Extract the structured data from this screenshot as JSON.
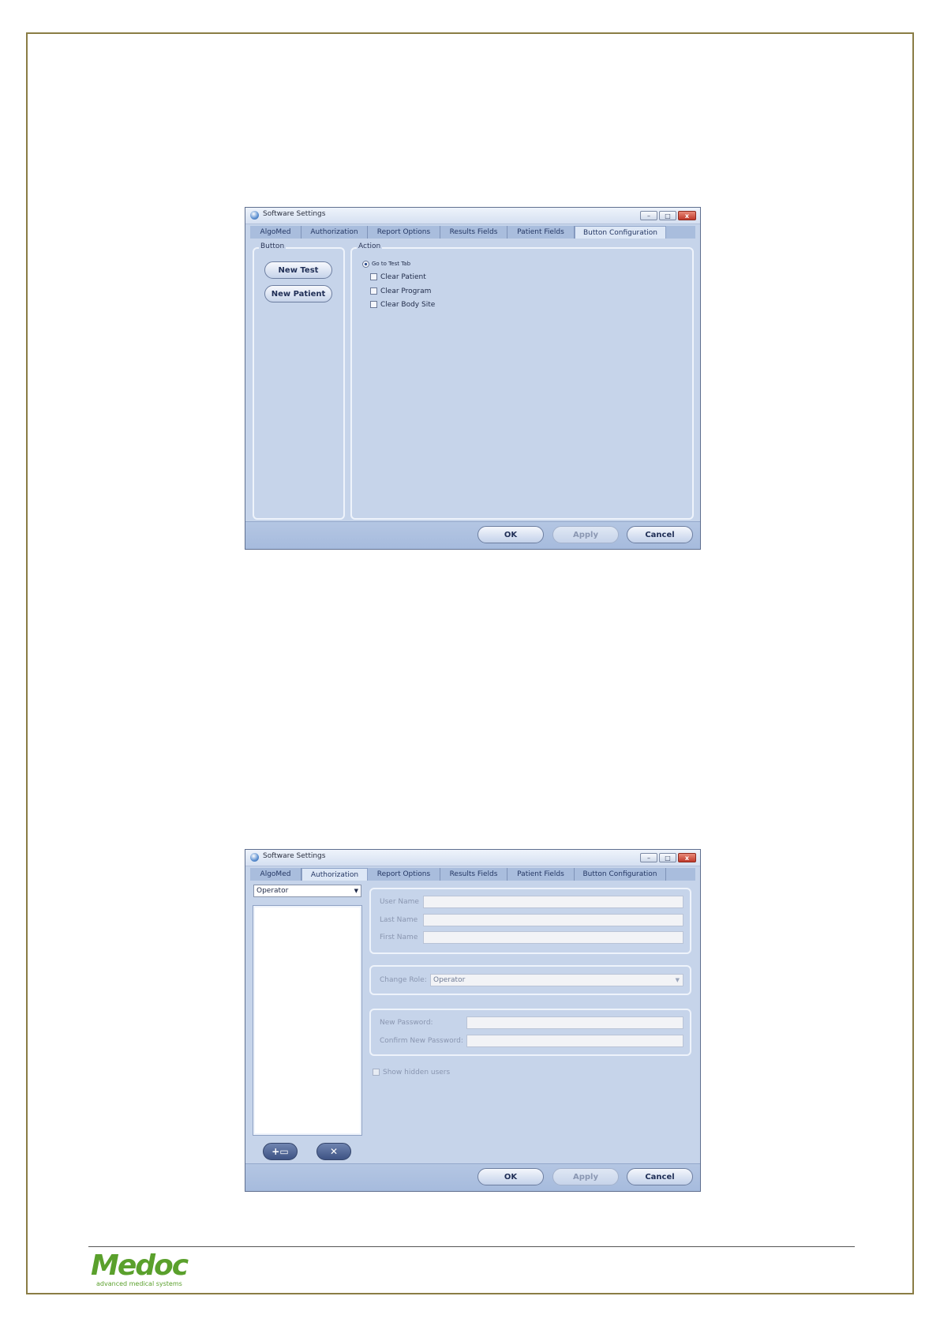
{
  "window_title": "Software Settings",
  "window_buttons": {
    "minimize": "–",
    "maximize": "□",
    "close": "x"
  },
  "tabs": [
    "AlgoMed",
    "Authorization",
    "Report Options",
    "Results Fields",
    "Patient Fields",
    "Button Configuration"
  ],
  "footer_buttons": {
    "ok": "OK",
    "apply": "Apply",
    "cancel": "Cancel"
  },
  "screen1": {
    "active_tab": "Button Configuration",
    "button_group_label": "Button",
    "buttons": [
      "New Test",
      "New Patient"
    ],
    "action_group_label": "Action",
    "radio_option": "Go to Test Tab",
    "checkboxes": [
      "Clear Patient",
      "Clear Program",
      "Clear Body Site"
    ]
  },
  "screen2": {
    "active_tab": "Authorization",
    "user_type_select": "Operator",
    "labels": {
      "user_name": "User Name",
      "last_name": "Last Name",
      "first_name": "First Name",
      "change_role": "Change Role:",
      "new_password": "New Password:",
      "confirm_password": "Confirm New Password:"
    },
    "change_role_value": "Operator",
    "show_hidden_users": "Show hidden users",
    "add_user_icon": "add-user-icon",
    "delete_user_icon": "delete-user-icon"
  },
  "logo": {
    "word": "Medoc",
    "tagline": "advanced medical systems",
    "color": "#5aa02c"
  }
}
